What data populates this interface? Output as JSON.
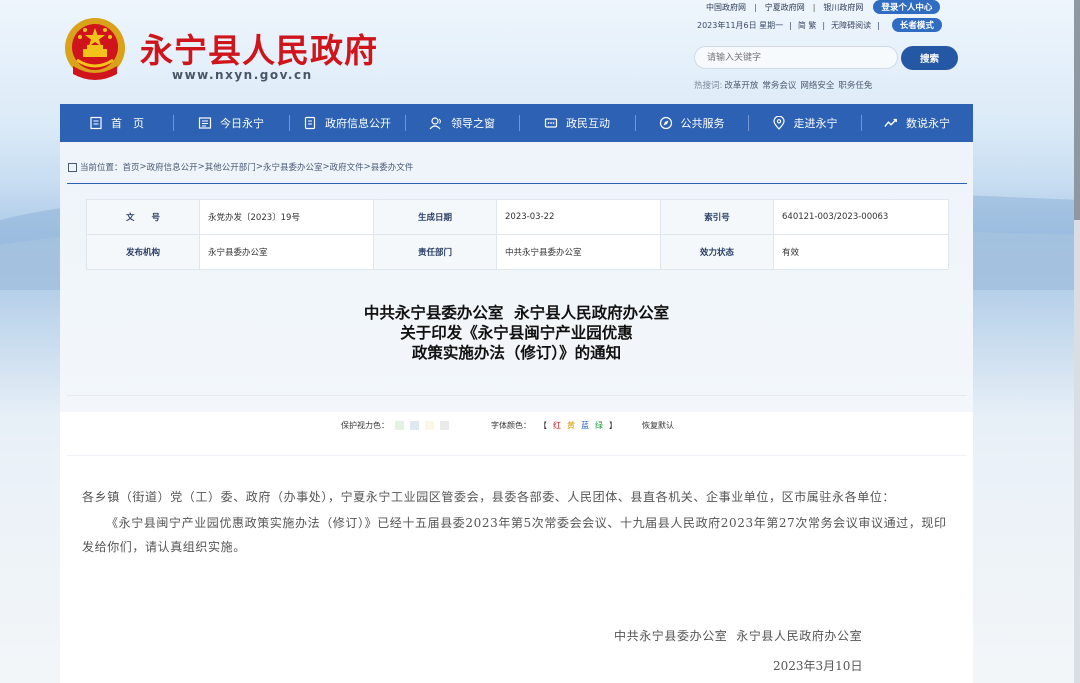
{
  "top_links": {
    "items": [
      "中国政府网",
      "宁夏政府网",
      "银川政府网"
    ],
    "personal_center": "登录个人中心",
    "date_text": "2023年11月6日 星期一",
    "simplified": "简 繁",
    "accessible": "无障碍阅读",
    "elder_mode": "长者模式"
  },
  "header": {
    "title": "永宁县人民政府",
    "url": "www.nxyn.gov.cn"
  },
  "search": {
    "placeholder": "请输入关键字",
    "button": "搜索",
    "hot_label": "热搜词:",
    "hot_words": [
      "改革开放",
      "常务会议",
      "网络安全",
      "职务任免"
    ]
  },
  "nav": {
    "items": [
      "首　页",
      "今日永宁",
      "政府信息公开",
      "领导之窗",
      "政民互动",
      "公共服务",
      "走进永宁",
      "数说永宁"
    ]
  },
  "breadcrumb": {
    "label": "当前位置：",
    "path": [
      "首页",
      "政府信息公开",
      "其他公开部门",
      "永宁县委办公室",
      "政府文件",
      "县委办文件"
    ]
  },
  "meta": {
    "doc_no_label": "文　　号",
    "doc_no": "永党办发〔2023〕19号",
    "date_label": "生成日期",
    "date": "2023-03-22",
    "index_label": "索引号",
    "index": "640121-003/2023-00063",
    "org_label": "发布机构",
    "org": "永宁县委办公室",
    "dept_label": "责任部门",
    "dept": "中共永宁县委办公室",
    "status_label": "效力状态",
    "status": "有效"
  },
  "document": {
    "title_lines": [
      "中共永宁县委办公室  永宁县人民政府办公室",
      "关于印发《永宁县闽宁产业园优惠",
      "政策实施办法（修订）》的通知"
    ],
    "paragraph1": "各乡镇（街道）党（工）委、政府（办事处），宁夏永宁工业园区管委会，县委各部委、人民团体、县直各机关、企事业单位，区市属驻永各单位：",
    "paragraph2": "《永宁县闽宁产业园优惠政策实施办法（修订）》已经十五届县委2023年第5次常委会会议、十九届县人民政府2023年第27次常务会议审议通过，现印发给你们，请认真组织实施。",
    "signature": "中共永宁县委办公室  永宁县人民政府办公室",
    "sign_date": "2023年3月10日"
  },
  "tools": {
    "eye_label": "保护视力色：",
    "font_color_label": "字体颜色：",
    "bracket_open": "【",
    "bracket_close": "】",
    "colors": [
      {
        "name": "红",
        "color": "#d0141b"
      },
      {
        "name": "黄",
        "color": "#d49b00"
      },
      {
        "name": "蓝",
        "color": "#1f5fbf"
      },
      {
        "name": "绿",
        "color": "#1c9a3a"
      }
    ],
    "swatches": [
      "#e3f3e3",
      "#dde8f3",
      "#fbf7e4",
      "#ebebeb"
    ],
    "restore": "恢复默认"
  },
  "colors": {
    "nav_bg": "#2c61b3",
    "title_red": "#d0141b",
    "search_button": "#2458a5"
  }
}
